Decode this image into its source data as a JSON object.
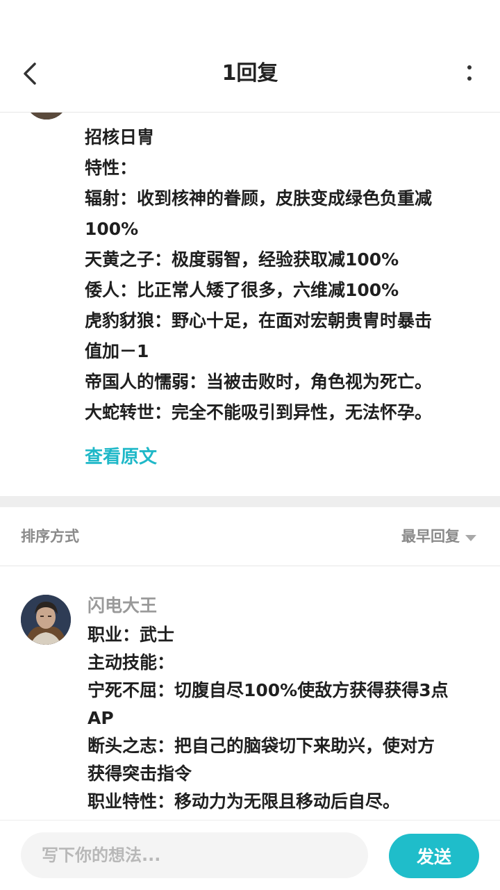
{
  "header": {
    "title": "1回复"
  },
  "original_post": {
    "lines": [
      "招核日冑",
      "特性：",
      "辐射：收到核神的眷顾，皮肤变成绿色负重减",
      "100%",
      "天黄之子：极度弱智，经验获取减100%",
      "倭人：比正常人矮了很多，六维减100%",
      "虎豹豺狼：野心十足，在面对宏朝贵冑时暴击",
      "值加－1",
      "帝国人的懦弱：当被击败时，角色视为死亡。",
      "大蛇转世：完全不能吸引到异性，无法怀孕。"
    ],
    "view_original_label": "查看原文"
  },
  "sort_bar": {
    "label": "排序方式",
    "value": "最早回复"
  },
  "reply": {
    "author": "闪电大王",
    "lines": [
      "职业：武士",
      "主动技能：",
      "宁死不屈：切腹自尽100%使敌方获得获得3点",
      "AP",
      "断头之志：把自己的脑袋切下来助兴，使对方",
      "获得突击指令",
      "职业特性：移动力为无限且移动后自尽。"
    ]
  },
  "bottom_bar": {
    "placeholder": "写下你的想法...",
    "send_label": "发送"
  },
  "colors": {
    "accent": "#1fbdca",
    "link": "#1fb8c8",
    "muted": "#9a9a9a"
  }
}
